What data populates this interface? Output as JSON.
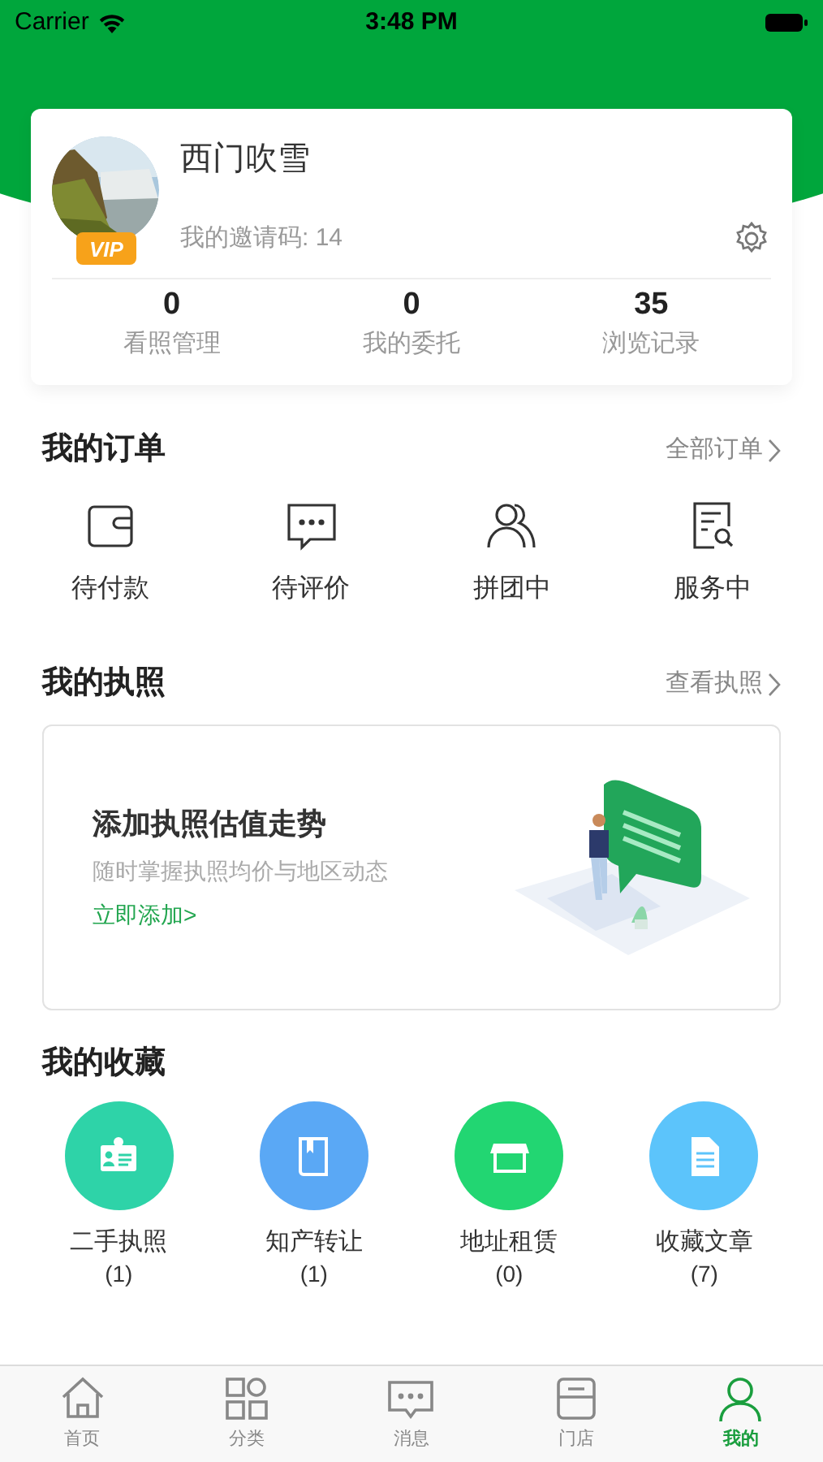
{
  "status_bar": {
    "carrier": "Carrier",
    "time": "3:48 PM"
  },
  "profile": {
    "name": "西门吹雪",
    "badge": "VIP",
    "invite_code": "我的邀请码: 14"
  },
  "stats": [
    {
      "value": "0",
      "label": "看照管理"
    },
    {
      "value": "0",
      "label": "我的委托"
    },
    {
      "value": "35",
      "label": "浏览记录"
    }
  ],
  "orders": {
    "title": "我的订单",
    "link": "全部订单",
    "items": [
      {
        "kind": "wallet",
        "label": "待付款"
      },
      {
        "kind": "chat",
        "label": "待评价"
      },
      {
        "kind": "group",
        "label": "拼团中"
      },
      {
        "kind": "doc-search",
        "label": "服务中"
      }
    ]
  },
  "licenses": {
    "title": "我的执照",
    "link": "查看执照",
    "card": {
      "title": "添加执照估值走势",
      "subtitle": "随时掌握执照均价与地区动态",
      "action": "立即添加>"
    }
  },
  "favorites": {
    "title": "我的收藏",
    "items": [
      {
        "kind": "id-card",
        "label": "二手执照",
        "count": "(1)",
        "color": "#2ed3a8"
      },
      {
        "kind": "book",
        "label": "知产转让",
        "count": "(1)",
        "color": "#5aa8f5"
      },
      {
        "kind": "shop",
        "label": "地址租赁",
        "count": "(0)",
        "color": "#22d672"
      },
      {
        "kind": "document",
        "label": "收藏文章",
        "count": "(7)",
        "color": "#5cc4fb"
      }
    ]
  },
  "tab_bar": [
    {
      "kind": "home",
      "label": "首页",
      "selected": false
    },
    {
      "kind": "grid",
      "label": "分类",
      "selected": false
    },
    {
      "kind": "message",
      "label": "消息",
      "selected": false
    },
    {
      "kind": "store",
      "label": "门店",
      "selected": false
    },
    {
      "kind": "person",
      "label": "我的",
      "selected": true
    }
  ]
}
